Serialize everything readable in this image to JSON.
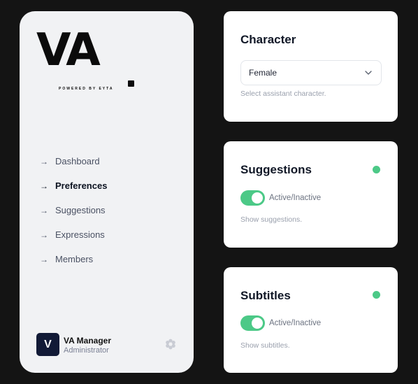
{
  "sidebar": {
    "logo": {
      "mark": "VA",
      "tagline": "POWERED BY EYTA"
    },
    "nav": [
      {
        "label": "Dashboard",
        "active": false
      },
      {
        "label": "Preferences",
        "active": true
      },
      {
        "label": "Suggestions",
        "active": false
      },
      {
        "label": "Expressions",
        "active": false
      },
      {
        "label": "Members",
        "active": false
      }
    ],
    "nav_icon": "arrow-right-icon",
    "user": {
      "initial": "V",
      "name": "VA Manager",
      "role": "Administrator",
      "settings_icon": "gear-icon"
    }
  },
  "character": {
    "title": "Character",
    "selected": "Female",
    "hint": "Select assistant character."
  },
  "suggestions": {
    "title": "Suggestions",
    "status": "active",
    "toggle_on": true,
    "toggle_label": "Active/Inactive",
    "hint": "Show suggestions."
  },
  "subtitles": {
    "title": "Subtitles",
    "status": "active",
    "toggle_on": true,
    "toggle_label": "Active/Inactive",
    "hint": "Show subtitles."
  },
  "colors": {
    "background": "#141414",
    "panel": "#f1f2f4",
    "accent": "#4cc987",
    "avatar_bg": "#121a36"
  }
}
